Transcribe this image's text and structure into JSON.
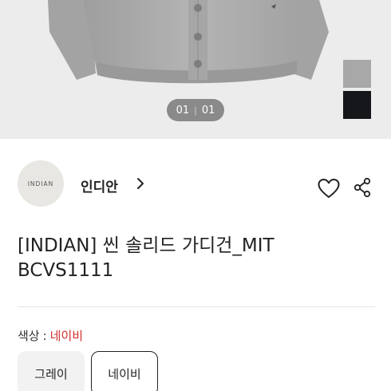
{
  "product_image": {
    "pager_current": "01",
    "pager_total": "01",
    "swatches": [
      {
        "name": "gray",
        "color": "#a8a8a8"
      },
      {
        "name": "navy",
        "color": "#15171b"
      }
    ]
  },
  "brand": {
    "logo_text": "INDIAN",
    "name": "인디안",
    "chevron_icon": "chevron-right-icon"
  },
  "actions": {
    "wishlist_icon": "heart-icon",
    "share_icon": "share-icon"
  },
  "product": {
    "title": "[INDIAN] 씬 솔리드 가디건_MIT BCVS1111"
  },
  "color_option": {
    "label": "색상",
    "colon": ":",
    "selected_value": "네이비",
    "selected_color": "#d0312d",
    "options": [
      "그레이",
      "네이비"
    ]
  }
}
